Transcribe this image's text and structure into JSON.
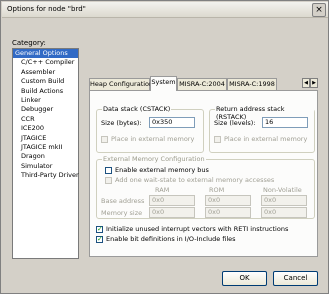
{
  "window": {
    "title": "Options for node \"brd\"",
    "close_glyph": "×"
  },
  "category": {
    "label": "Category:",
    "items": [
      {
        "label": "General Options",
        "selected": true,
        "child": false
      },
      {
        "label": "C/C++ Compiler",
        "child": true
      },
      {
        "label": "Assembler",
        "child": true
      },
      {
        "label": "Custom Build",
        "child": true
      },
      {
        "label": "Build Actions",
        "child": true
      },
      {
        "label": "Linker",
        "child": true
      },
      {
        "label": "Debugger",
        "child": true
      },
      {
        "label": "CCR",
        "child": true
      },
      {
        "label": "ICE200",
        "child": true
      },
      {
        "label": "JTAGICE",
        "child": true
      },
      {
        "label": "JTAGICE mkII",
        "child": true
      },
      {
        "label": "Dragon",
        "child": true
      },
      {
        "label": "Simulator",
        "child": true
      },
      {
        "label": "Third-Party Driver",
        "child": true
      }
    ]
  },
  "tabs": [
    {
      "label": "Heap Configuration"
    },
    {
      "label": "System",
      "active": true
    },
    {
      "label": "MISRA-C:2004"
    },
    {
      "label": "MISRA-C:1998"
    }
  ],
  "data_stack": {
    "title": "Data stack (CSTACK)",
    "size_label": "Size (bytes):",
    "size_value": "0x350",
    "external_label": "Place in external memory"
  },
  "return_stack": {
    "title": "Return address stack (RSTACK)",
    "size_label": "Size (levels):",
    "size_value": "16",
    "external_label": "Place in external memory"
  },
  "ext_mem": {
    "title": "External Memory Configuration",
    "enable_bus_label": "Enable external memory bus",
    "wait_state_label": "Add one wait-state to external memory accesses",
    "col_ram": "RAM",
    "col_rom": "ROM",
    "col_nonvolatile": "Non-Volatile",
    "base_label": "Base address",
    "size_label": "Memory size",
    "base_ram": "0x0",
    "base_rom": "0x0",
    "base_nv": "0x0",
    "size_ram": "0x0",
    "size_rom": "0x0",
    "size_nv": "0x0"
  },
  "options": {
    "init_vectors_label": "Initialize unused interrupt vectors with RETI instructions",
    "bit_defs_label": "Enable bit definitions in I/O-Include files",
    "check_glyph": "✓"
  },
  "buttons": {
    "ok": "OK",
    "cancel": "Cancel"
  },
  "tab_arrows": {
    "left": "◀",
    "right": "▶"
  }
}
